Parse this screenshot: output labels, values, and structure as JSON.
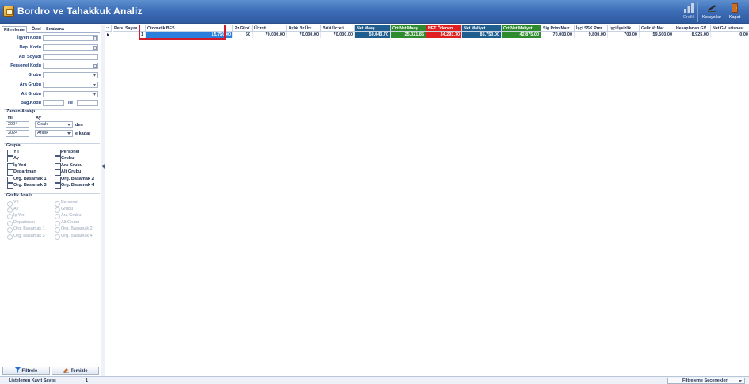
{
  "window": {
    "title": "Bordro ve Tahakkuk Analiz"
  },
  "toolbar": {
    "grafik_label": "Grafik",
    "kisayollar_label": "Kısayollar",
    "kapat_label": "Kapat"
  },
  "tabs": [
    "Filtreleme",
    "Özel",
    "Sıralama"
  ],
  "filters": {
    "isyeri_kodu": "İşyeri Kodu",
    "dep_kodu": "Dep. Kodu",
    "adi_soyadi": "Adı Soyadı",
    "personel_kodu": "Personel Kodu",
    "grubu": "Grubu",
    "ara_grubu": "Ara Grubu",
    "alt_grubu": "Alt Grubu",
    "bag_kodu": "Bağ.Kodu",
    "ile": "ile"
  },
  "zaman": {
    "title": "Zaman Aralığı",
    "yil_label": "Yıl",
    "ay_label": "Ay",
    "start_year": "2024",
    "start_month": "Ocak",
    "den": "den",
    "end_year": "2024",
    "end_month": "Aralık",
    "e_kadar": "e kadar"
  },
  "grupla": {
    "title": "Grupla",
    "left": [
      "Yıl",
      "Ay",
      "İş Yeri",
      "Departman",
      "Org. Basamak 1",
      "Org. Basamak 3"
    ],
    "right": [
      "Personel",
      "Grubu",
      "Ara Grubu",
      "Alt Grubu",
      "Org. Basamak 2",
      "Org. Basamak 4"
    ]
  },
  "grafik_analiz": {
    "title": "Grafik Analiz",
    "left": [
      "Yıl",
      "Ay",
      "İş Yeri",
      "Departman",
      "Org. Basamak 1",
      "Org. Basamak 3"
    ],
    "right": [
      "Personel",
      "Grubu",
      "Ara Grubu",
      "Alt Grubu",
      "Org. Basamak 2",
      "Org. Basamak 4"
    ]
  },
  "buttons": {
    "filtrele": "Filtrele",
    "temizle": "Temizle"
  },
  "grid": {
    "columns": [
      {
        "label": "Pers. Sayısı",
        "bg": "#ffffff",
        "fg": "#1a2a4a"
      },
      {
        "label": "Otomatik BES",
        "bg": "#ffffff",
        "fg": "#1a2a4a"
      },
      {
        "label": "Pr.Günü",
        "bg": "#ffffff",
        "fg": "#1a2a4a"
      },
      {
        "label": "Ücreti",
        "bg": "#ffffff",
        "fg": "#1a2a4a"
      },
      {
        "label": "Aylık Br.Ücr.",
        "bg": "#ffffff",
        "fg": "#1a2a4a"
      },
      {
        "label": "Brüt Ücreti",
        "bg": "#ffffff",
        "fg": "#1a2a4a"
      },
      {
        "label": "Net Maaş",
        "bg": "#1f5f8f",
        "fg": "#ffffff"
      },
      {
        "label": "Ort.Net Maaş",
        "bg": "#2e8b2e",
        "fg": "#ffffff"
      },
      {
        "label": "NET Ödenen",
        "bg": "#e02020",
        "fg": "#ffffff"
      },
      {
        "label": "Net Maliyet",
        "bg": "#1f5f8f",
        "fg": "#ffffff"
      },
      {
        "label": "Ort.Net Maliyet",
        "bg": "#2e8b2e",
        "fg": "#ffffff"
      },
      {
        "label": "Sig.Prim Matr.",
        "bg": "#ffffff",
        "fg": "#1a2a4a"
      },
      {
        "label": "İşçi SSK Prm",
        "bg": "#ffffff",
        "fg": "#1a2a4a"
      },
      {
        "label": "İşçi İşsizlik",
        "bg": "#ffffff",
        "fg": "#1a2a4a"
      },
      {
        "label": "Gelir Vr.Mat.",
        "bg": "#ffffff",
        "fg": "#1a2a4a"
      },
      {
        "label": "Hesaplanan GV",
        "bg": "#ffffff",
        "fg": "#1a2a4a"
      },
      {
        "label": "Net GV İstisnası",
        "bg": "#ffffff",
        "fg": "#1a2a4a"
      }
    ],
    "rows": [
      [
        "1",
        "15.750,00",
        "60",
        "70.000,00",
        "70.000,00",
        "70.000,00",
        "50.043,70",
        "25.021,85",
        "34.293,70",
        "85.750,00",
        "42.875,00",
        "70.000,00",
        "9.800,00",
        "700,00",
        "59.500,00",
        "8.925,00",
        "0,00"
      ]
    ],
    "selected_cell_bg": "#2a7fdc"
  },
  "status": {
    "label": "Listelenen Kayıt Sayısı",
    "value": "1",
    "filter_options": "Filtreleme Seçenekleri"
  }
}
